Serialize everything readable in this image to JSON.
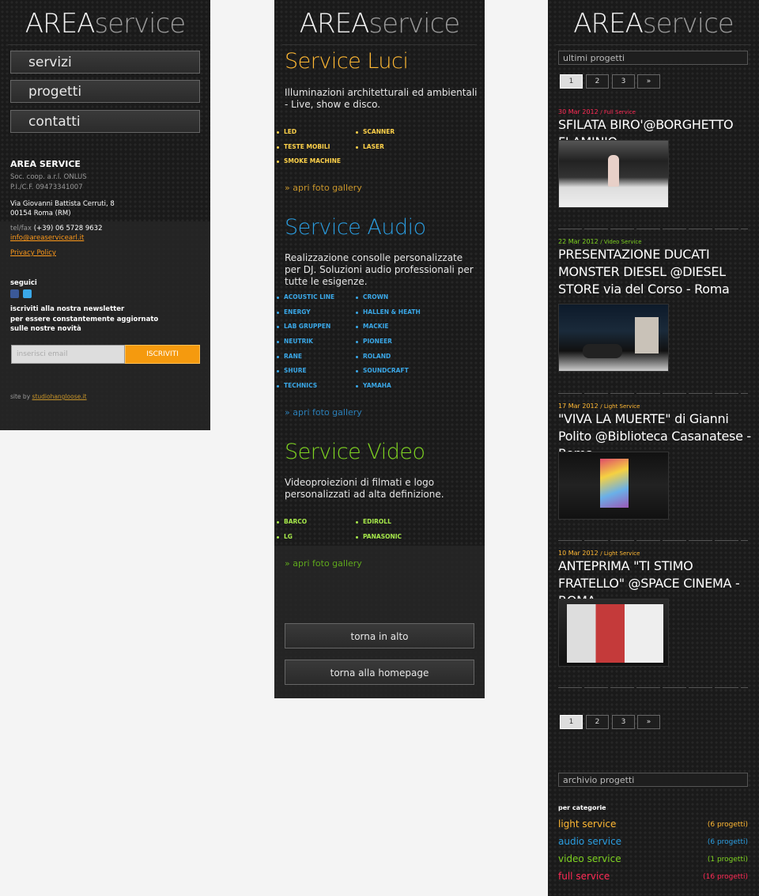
{
  "logo": {
    "bold": "AREA",
    "light": "service"
  },
  "left": {
    "nav": [
      "servizi",
      "progetti",
      "contatti"
    ],
    "company": {
      "name": "AREA SERVICE",
      "line1": "Soc. coop. a.r.l. ONLUS",
      "line2": "P.I./C.F. 09473341007",
      "address1": "Via Giovanni Battista Cerruti, 8",
      "address2": "00154 Roma (RM)",
      "phone_label": "tel/fax",
      "phone": "(+39) 06 5728 9632",
      "email": "info@areaservicearl.it",
      "privacy": "Privacy Policy"
    },
    "social_label": "seguici",
    "newsletter_text": [
      "iscriviti alla nostra newsletter",
      "per essere constantemente aggiornato",
      "sulle nostre novità"
    ],
    "email_placeholder": "inserisci email",
    "subscribe": "ISCRIVITI",
    "credit_prefix": "site by",
    "credit_link": "studiohangloose.it"
  },
  "middle": {
    "services": [
      {
        "title": "Service Luci",
        "color": "#ffb833",
        "desc": "Illuminazioni architetturali ed ambientali - Live, show e disco.",
        "brands_left": [
          "LED",
          "TESTE MOBILI",
          "SMOKE MACHINE"
        ],
        "brands_right": [
          "SCANNER",
          "LASER"
        ],
        "brand_color": "#ffd24a",
        "gallery": "» apri foto gallery",
        "gallery_color": "#c8952a"
      },
      {
        "title": "Service Audio",
        "color": "#2a9de0",
        "desc": "Realizzazione consolle personalizzate per DJ. Soluzioni audio professionali per tutte le esigenze.",
        "brands_left": [
          "ACOUSTIC LINE",
          "ENERGY",
          "LAB GRUPPEN",
          "NEUTRIK",
          "RANE",
          "SHURE",
          "TECHNICS"
        ],
        "brands_right": [
          "CROWN",
          "HALLEN & HEATH",
          "MACKIE",
          "PIONEER",
          "ROLAND",
          "SOUNDCRAFT",
          "YAMAHA"
        ],
        "brand_color": "#3aa8e8",
        "gallery": "» apri foto gallery",
        "gallery_color": "#2a7fb8"
      },
      {
        "title": "Service Video",
        "color": "#7ed321",
        "desc": "Videoproiezioni di filmati e logo personalizzati ad alta definizione.",
        "brands_left": [
          "BARCO",
          "LG"
        ],
        "brands_right": [
          "EDIROLL",
          "PANASONIC"
        ],
        "brand_color": "#a6e84a",
        "gallery": "» apri foto gallery",
        "gallery_color": "#5fa81c"
      }
    ],
    "back_top": "torna in alto",
    "back_home": "torna alla homepage"
  },
  "right": {
    "section_label": "ultimi progetti",
    "pagination": [
      "1",
      "2",
      "3",
      "»"
    ],
    "projects": [
      {
        "date": "30 Mar 2012",
        "category": "/ Full Service",
        "color": "#ff2a55",
        "title": "SFILATA BIRO'@BORGHETTO FLAMINIO"
      },
      {
        "date": "22 Mar 2012",
        "category": "/ Video Service",
        "color": "#7ed321",
        "title": "PRESENTAZIONE DUCATI MONSTER DIESEL @DIESEL STORE via del Corso - Roma"
      },
      {
        "date": "17 Mar 2012",
        "category": "/ Light Service",
        "color": "#ffb833",
        "title": "\"VIVA LA MUERTE\" di Gianni Polito @Biblioteca Casanatese - Roma"
      },
      {
        "date": "10 Mar 2012",
        "category": "/ Light Service",
        "color": "#ffb833",
        "title": "ANTEPRIMA \"TI STIMO FRATELLO\" @SPACE CINEMA - ROMA"
      }
    ],
    "archive_label": "archivio progetti",
    "categories_label": "per categorie",
    "categories": [
      {
        "name": "light service",
        "count": "(6 progetti)",
        "color": "#ffb833"
      },
      {
        "name": "audio service",
        "count": "(6 progetti)",
        "color": "#2a9de0"
      },
      {
        "name": "video service",
        "count": "(1 progetti)",
        "color": "#7ed321"
      },
      {
        "name": "full service",
        "count": "(16 progetti)",
        "color": "#ff2a55"
      }
    ]
  }
}
